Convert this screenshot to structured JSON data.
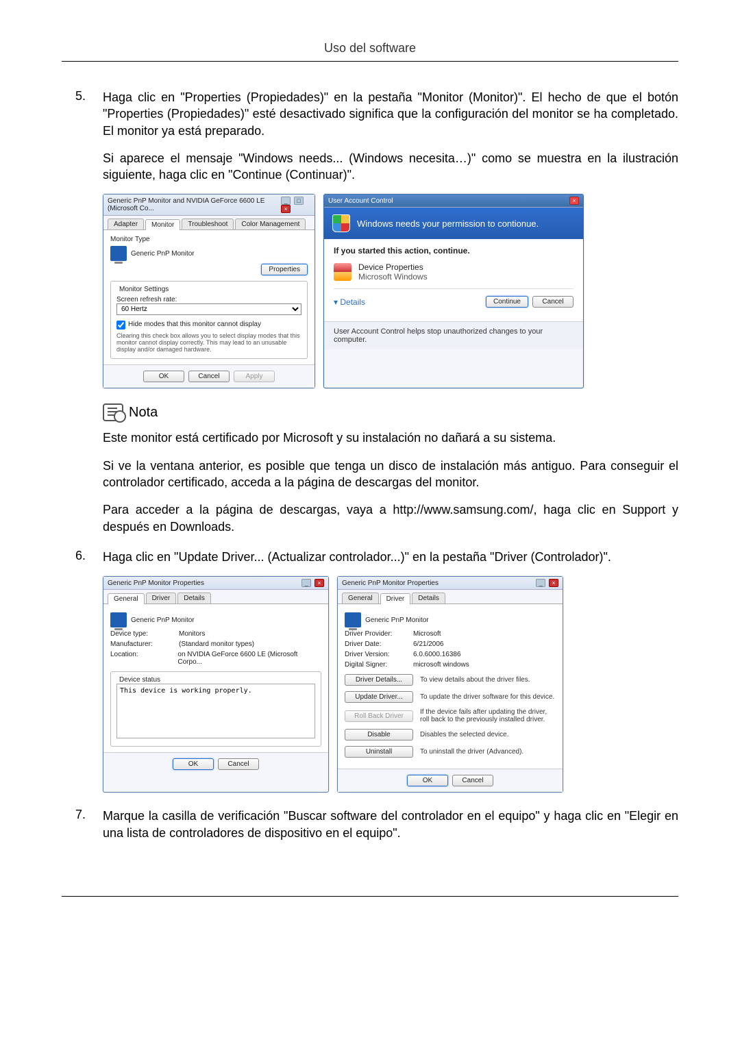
{
  "header": {
    "title": "Uso del software"
  },
  "steps": {
    "s5num": "5.",
    "s5p1": "Haga clic en \"Properties (Propiedades)\" en la pestaña \"Monitor (Monitor)\". El hecho de que el botón \"Properties (Propiedades)\" esté desactivado significa que la configuración del monitor se ha completado. El monitor ya está preparado.",
    "s5p2": "Si aparece el mensaje \"Windows needs... (Windows necesita…)\" como se muestra en la ilustración siguiente, haga clic en \"Continue (Continuar)\".",
    "s6num": "6.",
    "s6p1": "Haga clic en \"Update Driver... (Actualizar controlador...)\" en la pestaña \"Driver (Controlador)\".",
    "s7num": "7.",
    "s7p1": "Marque la casilla de verificación \"Buscar software del controlador en el equipo\" y haga clic en \"Elegir en una lista de controladores de dispositivo en el equipo\"."
  },
  "note": {
    "title": "Nota",
    "p1": "Este monitor está certificado por Microsoft y su instalación no dañará a su sistema.",
    "p2": "Si ve la ventana anterior, es posible que tenga un disco de instalación más antiguo. Para conseguir el controlador certificado, acceda a la página de descargas del monitor.",
    "p3": "Para acceder a la página de descargas, vaya a http://www.samsung.com/, haga clic en Support y después en Downloads."
  },
  "monitorDialog": {
    "title": "Generic PnP Monitor and NVIDIA GeForce 6600 LE (Microsoft Co...",
    "tabs": {
      "adapter": "Adapter",
      "monitor": "Monitor",
      "troubleshoot": "Troubleshoot",
      "colormgmt": "Color Management"
    },
    "monitorTypeLabel": "Monitor Type",
    "monitorName": "Generic PnP Monitor",
    "propertiesBtn": "Properties",
    "settingsLabel": "Monitor Settings",
    "refreshLabel": "Screen refresh rate:",
    "refreshValue": "60 Hertz",
    "hideModes": "Hide modes that this monitor cannot display",
    "clearingText": "Clearing this check box allows you to select display modes that this monitor cannot display correctly. This may lead to an unusable display and/or damaged hardware.",
    "ok": "OK",
    "cancel": "Cancel",
    "apply": "Apply"
  },
  "uac": {
    "title": "User Account Control",
    "banner": "Windows needs your permission to contionue.",
    "ifstarted": "If you started this action, continue.",
    "progTitle": "Device Properties",
    "progPub": "Microsoft Windows",
    "details": "Details",
    "continue": "Continue",
    "cancel": "Cancel",
    "footer": "User Account Control helps stop unauthorized changes to your computer."
  },
  "generalDialog": {
    "title": "Generic PnP Monitor Properties",
    "tabs": {
      "general": "General",
      "driver": "Driver",
      "details": "Details"
    },
    "name": "Generic PnP Monitor",
    "devtypeK": "Device type:",
    "devtypeV": "Monitors",
    "mfrK": "Manufacturer:",
    "mfrV": "(Standard monitor types)",
    "locK": "Location:",
    "locV": "on NVIDIA GeForce 6600 LE (Microsoft Corpo...",
    "statusLabel": "Device status",
    "statusText": "This device is working properly.",
    "ok": "OK",
    "cancel": "Cancel"
  },
  "driverDialog": {
    "title": "Generic PnP Monitor Properties",
    "tabs": {
      "general": "General",
      "driver": "Driver",
      "details": "Details"
    },
    "name": "Generic PnP Monitor",
    "provK": "Driver Provider:",
    "provV": "Microsoft",
    "dateK": "Driver Date:",
    "dateV": "6/21/2006",
    "verK": "Driver Version:",
    "verV": "6.0.6000.16386",
    "signK": "Digital Signer:",
    "signV": "microsoft windows",
    "btnDetails": "Driver Details...",
    "descDetails": "To view details about the driver files.",
    "btnUpdate": "Update Driver...",
    "descUpdate": "To update the driver software for this device.",
    "btnRoll": "Roll Back Driver",
    "descRoll": "If the device fails after updating the driver, roll back to the previously installed driver.",
    "btnDisable": "Disable",
    "descDisable": "Disables the selected device.",
    "btnUninstall": "Uninstall",
    "descUninstall": "To uninstall the driver (Advanced).",
    "ok": "OK",
    "cancel": "Cancel"
  }
}
